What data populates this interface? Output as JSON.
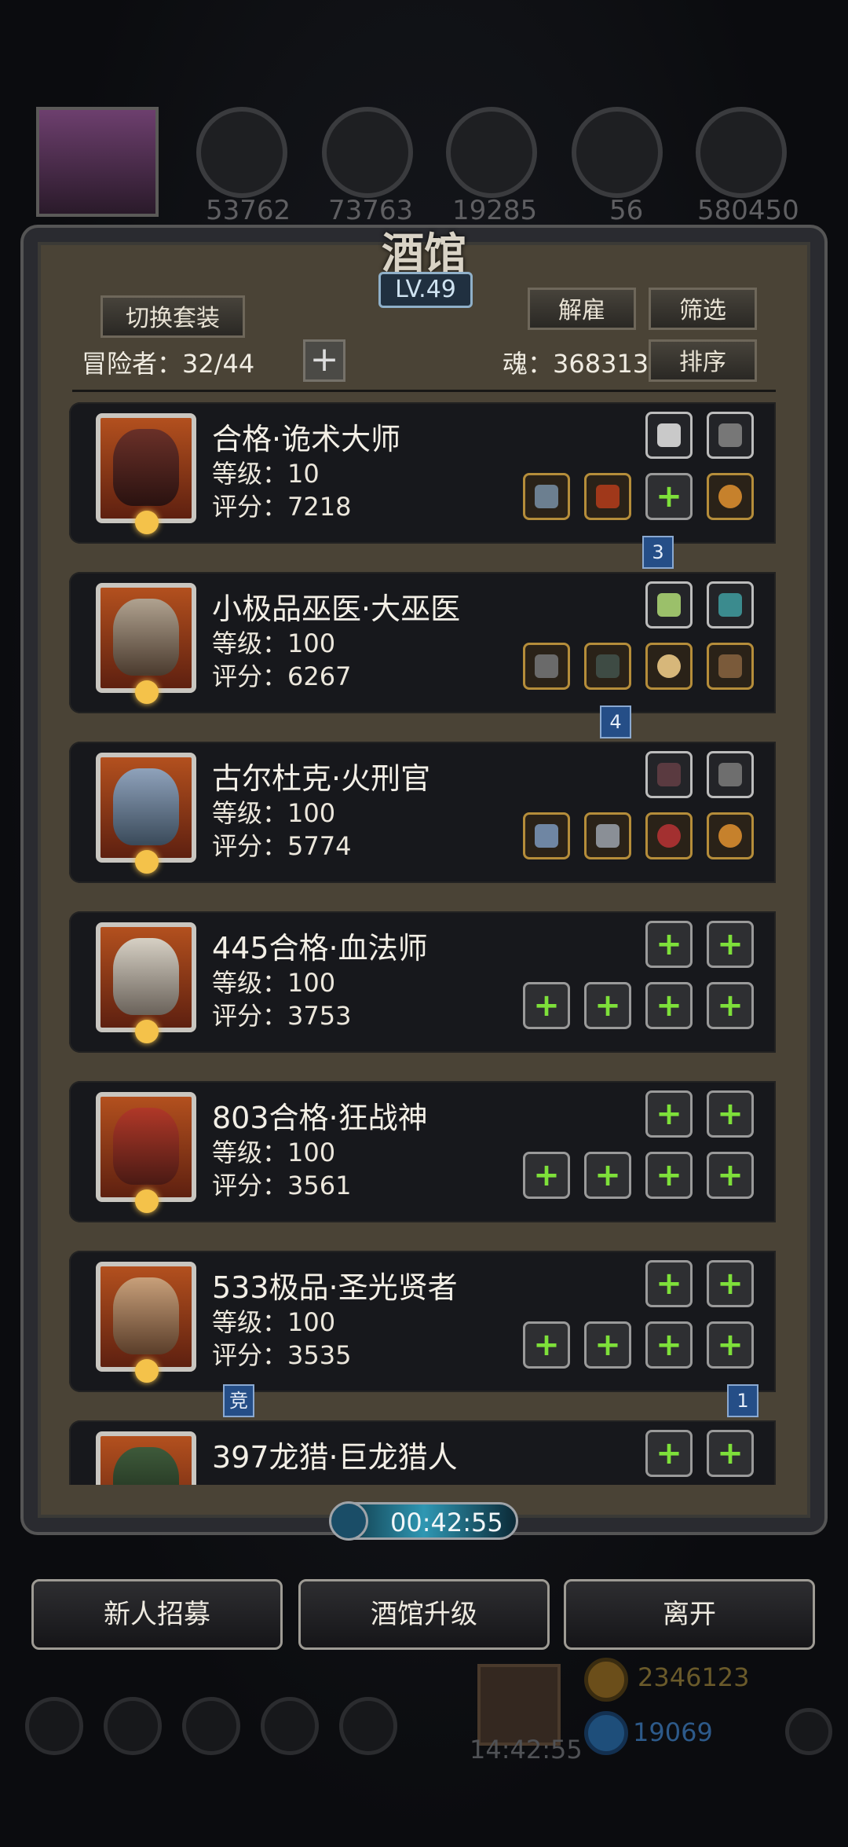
{
  "top": {
    "resources": [
      "53762",
      "73763",
      "19285",
      "56",
      "580450"
    ]
  },
  "panel": {
    "title": "酒馆",
    "level": "LV.49",
    "switch_outfit": "切换套装",
    "dismiss": "解雇",
    "filter": "筛选",
    "sort": "排序",
    "adventurers": "冒险者：32/44",
    "soul": "魂：368313"
  },
  "heroes": [
    {
      "name": "合格·诡术大师",
      "level": "等级：10",
      "score": "评分：7218",
      "icons": [
        "stone",
        "stone",
        "staff",
        "demon",
        "add",
        "ring"
      ]
    },
    {
      "name": "小极品巫医·大巫医",
      "level": "等级：100",
      "score": "评分：6267",
      "icons": [
        "lantern",
        "stone",
        "staff",
        "armor",
        "amulet",
        "bow"
      ]
    },
    {
      "name": "古尔杜克·火刑官",
      "level": "等级：100",
      "score": "评分：5774",
      "icons": [
        "feather",
        "sword",
        "axe",
        "beast",
        "skull",
        "ring"
      ]
    },
    {
      "name": "445合格·血法师",
      "level": "等级：100",
      "score": "评分：3753",
      "icons": [
        "add",
        "add",
        "add",
        "add",
        "add",
        "add"
      ]
    },
    {
      "name": "803合格·狂战神",
      "level": "等级：100",
      "score": "评分：3561",
      "icons": [
        "add",
        "add",
        "add",
        "add",
        "add",
        "add"
      ]
    },
    {
      "name": "533极品·圣光贤者",
      "level": "等级：100",
      "score": "评分：3535",
      "icons": [
        "add",
        "add",
        "add",
        "add",
        "add",
        "add"
      ]
    },
    {
      "name": "397龙猎·巨龙猎人",
      "level": "",
      "score": "",
      "icons": [
        "add",
        "add"
      ]
    }
  ],
  "tags": {
    "t3": "3",
    "t4": "4",
    "compete": "竞",
    "t1": "1"
  },
  "timer": "00:42:55",
  "buttons": {
    "recruit": "新人招募",
    "upgrade": "酒馆升级",
    "leave": "离开"
  },
  "bottom": {
    "clock": "14:42:55",
    "gold": "2346123",
    "gems": "19069"
  }
}
